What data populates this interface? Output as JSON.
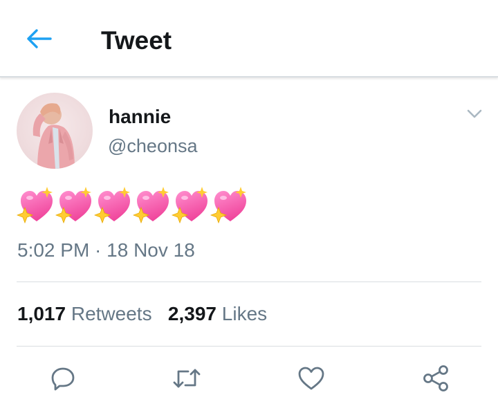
{
  "header": {
    "title": "Tweet",
    "back_icon": "arrow-left-icon"
  },
  "author": {
    "display_name": "hannie",
    "handle": "@cheonsa"
  },
  "tweet": {
    "text": "💖💖💖💖💖💖",
    "emoji_name": "sparkling-heart",
    "emoji_count": 6,
    "timestamp": "5:02 PM · 18 Nov 18"
  },
  "stats": {
    "retweets_count": "1,017",
    "retweets_label": "Retweets",
    "likes_count": "2,397",
    "likes_label": "Likes"
  },
  "actions": [
    "reply-icon",
    "retweet-icon",
    "like-icon",
    "share-icon"
  ],
  "colors": {
    "accent": "#1da1f2",
    "text_primary": "#14171a",
    "text_secondary": "#657786",
    "divider": "#d8dde1",
    "heart_pink": "#f0469c",
    "sparkle": "#ffcc33"
  }
}
